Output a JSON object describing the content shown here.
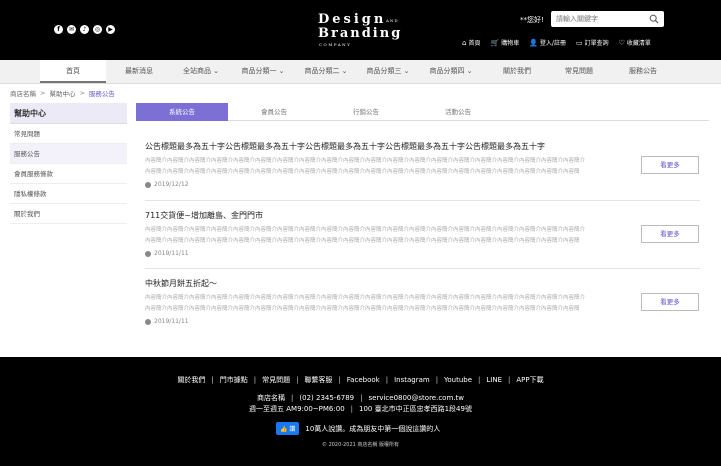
{
  "header": {
    "social": [
      "f",
      "✉",
      "♪",
      "◎",
      "▶"
    ],
    "logo": {
      "line1": "Design",
      "and": "AND",
      "line2": "Branding",
      "line3": "COMPANY"
    },
    "hello": "**您好!",
    "search_placeholder": "請輸入關鍵字",
    "links": [
      {
        "icon": "⌂",
        "label": "首頁"
      },
      {
        "icon": "🛒",
        "label": "購物車"
      },
      {
        "icon": "👤",
        "label": "登入/註冊"
      },
      {
        "icon": "▭",
        "label": "訂單查詢"
      },
      {
        "icon": "♡",
        "label": "收藏清單"
      }
    ]
  },
  "nav": [
    {
      "label": "首頁"
    },
    {
      "label": "最新消息"
    },
    {
      "label": "全站商品 ⌄"
    },
    {
      "label": "商品分類一 ⌄"
    },
    {
      "label": "商品分類二 ⌄"
    },
    {
      "label": "商品分類三 ⌄"
    },
    {
      "label": "商品分類四 ⌄"
    },
    {
      "label": "關於我們"
    },
    {
      "label": "常見問題"
    },
    {
      "label": "服務公告"
    }
  ],
  "breadcrumb": {
    "home": "商店名稱",
    "mid": "幫助中心",
    "current": "服務公告",
    "sep": ">"
  },
  "sidebar": {
    "title": "幫助中心",
    "items": [
      "常見問題",
      "服務公告",
      "會員服務條款",
      "隱私權條款",
      "關於我們"
    ]
  },
  "tabs": [
    "系統公告",
    "會員公告",
    "行銷公告",
    "活動公告"
  ],
  "posts": [
    {
      "title": "公告標題最多為五十字公告標題最多為五十字公告標題最多為五十字公告標題最多為五十字公告標題最多為五十字",
      "body": "內容簡介內容簡介內容簡介內容簡介內容簡介內容簡介內容簡介內容簡介內容簡介內容簡介內容簡介內容簡介內容簡介內容簡介內容簡介內容簡介內容簡介內容簡介內容簡介內容簡介內容簡介內容簡介內容簡介內容簡介內容簡介內容簡介內容簡介內容簡介內容簡介內容簡介內容簡介內容簡介內容簡介內容簡介內容簡介內容簡介內容簡介內容簡介內容簡介內容簡介...",
      "date": "2019/12/12",
      "button": "看更多"
    },
    {
      "title": "711交貨便~增加離島、金門門市",
      "body": "內容簡介內容簡介內容簡介內容簡介內容簡介內容簡介內容簡介內容簡介內容簡介內容簡介內容簡介內容簡介內容簡介內容簡介內容簡介內容簡介內容簡介內容簡介內容簡介內容簡介內容簡介內容簡介內容簡介內容簡介內容簡介內容簡介內容簡介內容簡介內容簡介內容簡介內容簡介內容簡介內容簡介內容簡介內容簡介內容簡介內容簡介內容簡介內容簡介內容簡介...",
      "date": "2019/11/11",
      "button": "看更多"
    },
    {
      "title": "中秋節月餅五折起～",
      "body": "內容簡介內容簡介內容簡介內容簡介內容簡介內容簡介內容簡介內容簡介內容簡介內容簡介內容簡介內容簡介內容簡介內容簡介內容簡介內容簡介內容簡介內容簡介內容簡介內容簡介內容簡介內容簡介內容簡介內容簡介內容簡介內容簡介內容簡介內容簡介內容簡介內容簡介內容簡介內容簡介內容簡介內容簡介內容簡介內容簡介內容簡介內容簡介內容簡介內容簡介...",
      "date": "2019/11/11",
      "button": "看更多"
    }
  ],
  "footer": {
    "links": [
      "關於我們",
      "門市據點",
      "常見問題",
      "聯繫客服",
      "Facebook",
      "Instagram",
      "Youtube",
      "LINE",
      "APP下載"
    ],
    "store": "商店名稱",
    "phone": "(02) 2345-6789",
    "email": "service0800@store.com.tw",
    "hours": "週一至週五 AM9:00~PM6:00",
    "address": "100 臺北市中正區忠孝西路1段49號",
    "fb_button": "👍 讚",
    "fb_text": "10萬人說讚。成為朋友中第一個說這讚的人",
    "copyright": "© 2020-2021 商店名稱 版權所有"
  }
}
